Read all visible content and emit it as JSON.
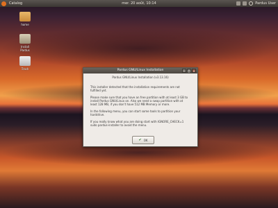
{
  "topbar": {
    "app_menu": "Catalog",
    "clock": "mer. 20 août, 10:14",
    "user": "Pardus User"
  },
  "desktop_icons": [
    {
      "label": "home",
      "icon": "folder-icon"
    },
    {
      "label": "Install Pardus",
      "icon": "package-icon"
    },
    {
      "label": "Trash",
      "icon": "trash-icon"
    }
  ],
  "dialog": {
    "window_title": "Pardus GNU/Linux Installation",
    "heading": "Pardus GNU/Linux Installation (v3.13.16)",
    "paragraphs": [
      "This installer detected that the installation requirements are not fulfilled yet.",
      "Please make sure that you have an free partition with at least 3 GB to install Pardus GNU/Linux on. Also we need a swap partition with at least 128 MB, if you don't have 512 MB Memory or more.",
      "In the following menu, you can start some tools to partition your harddrive.",
      "If you really know what you are doing start with IGNORE_CHECK=1 sudo pardus-installer to avoid the menu."
    ],
    "ok_label": "OK"
  },
  "colors": {
    "dialog_bg": "#efebe7",
    "titlebar": "#5c5751",
    "accent": "#e07020"
  }
}
